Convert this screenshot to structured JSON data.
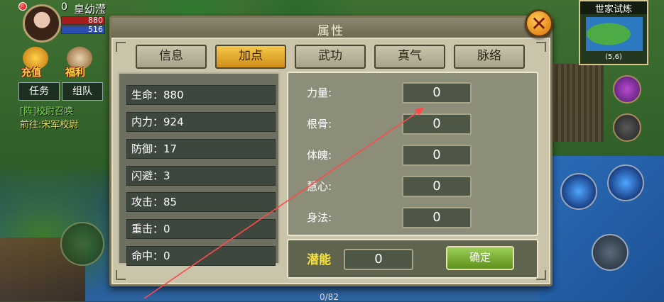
{
  "player": {
    "level": "0",
    "name": "皇幼滢",
    "hp": "880",
    "mp": "516"
  },
  "hud": {
    "recharge_label": "充值",
    "welfare_label": "福利",
    "task_button": "任务",
    "team_button": "组队",
    "quest_line1": "[阵]校尉召唤",
    "quest_line2": "前往:宋军校尉"
  },
  "minimap": {
    "title": "世家试炼",
    "coords": "(5,6)"
  },
  "bottom_counter": "0/82",
  "dialog": {
    "title": "属性",
    "close_symbol": "✕",
    "tabs": [
      {
        "label": "信息",
        "active": false
      },
      {
        "label": "加点",
        "active": true
      },
      {
        "label": "武功",
        "active": false
      },
      {
        "label": "真气",
        "active": false
      },
      {
        "label": "脉络",
        "active": false
      }
    ],
    "stats": [
      {
        "text": "生命：880"
      },
      {
        "text": "内力：924"
      },
      {
        "text": "防御：17"
      },
      {
        "text": "闪避：3"
      },
      {
        "text": "攻击：85"
      },
      {
        "text": "重击：0"
      },
      {
        "text": "命中：0"
      }
    ],
    "attributes": [
      {
        "label": "力量:",
        "value": "0"
      },
      {
        "label": "根骨:",
        "value": "0"
      },
      {
        "label": "体魄:",
        "value": "0"
      },
      {
        "label": "慧心:",
        "value": "0"
      },
      {
        "label": "身法:",
        "value": "0"
      }
    ],
    "potential_label": "潜能",
    "potential_value": "0",
    "confirm_label": "确定"
  },
  "colors": {
    "active_tab": "#e0a82a",
    "potential_label": "#f6e13a",
    "confirm_button": "#7cae34",
    "annotation_arrow": "#ff4a4a"
  }
}
